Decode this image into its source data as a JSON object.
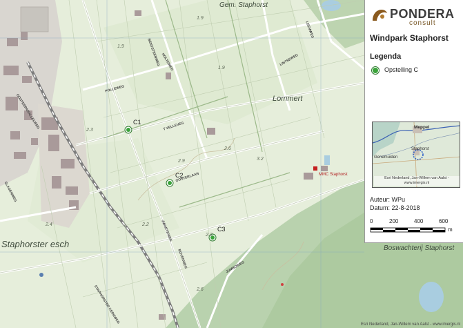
{
  "map": {
    "place_labels": [
      {
        "text": "Gem. Staphorst",
        "style": "big"
      },
      {
        "text": "Lommert",
        "style": "big"
      },
      {
        "text": "Staphorster esch",
        "style": "big"
      },
      {
        "text": "Boswachterij Staphorst",
        "style": "big"
      },
      {
        "text": "MMC Staphorst",
        "style": "small"
      }
    ],
    "road_labels": [
      "OOSTERPARALLELWEG",
      "POLLEWEG",
      "BENTSTEENWEG",
      "T VELLEVEG",
      "HOLTEWEG",
      "ZWARTEWEG",
      "LINTSEWEG",
      "OOSTERLAAN",
      "SLAGENWEG",
      "LEEMWEG",
      "BOVENWEG",
      "JUMBOWEG",
      "STAPHORSTER KERKWEG"
    ],
    "plot_numbers": [
      "1.9",
      "1.9",
      "1.9",
      "2.3",
      "2.3",
      "2.9",
      "2.2",
      "2.4",
      "2.6",
      "3.2",
      "2.6"
    ],
    "markers": [
      {
        "label": "C1"
      },
      {
        "label": "C2"
      },
      {
        "label": "C3"
      }
    ],
    "credit": "Esri Nederland, Jan-Willem van Aalst - www.imergis.nl"
  },
  "panel": {
    "logo_name": "PONDERA",
    "logo_sub": "consult",
    "title": "Windpark Staphorst",
    "legend_title": "Legenda",
    "legend_items": [
      {
        "label": "Opstelling C",
        "color": "#3aa33a"
      }
    ],
    "inset": {
      "labels": [
        "Meppel",
        "Staphorst",
        "Genemuiden"
      ],
      "credit": "Esri Nederland, Jan-Willem van Aalst - www.imergis.nl"
    },
    "author": "Auteur: WPu",
    "date": "Datum: 22-8-2018",
    "scale": {
      "ticks": [
        "0",
        "200",
        "400",
        "600"
      ],
      "unit": "m"
    }
  }
}
